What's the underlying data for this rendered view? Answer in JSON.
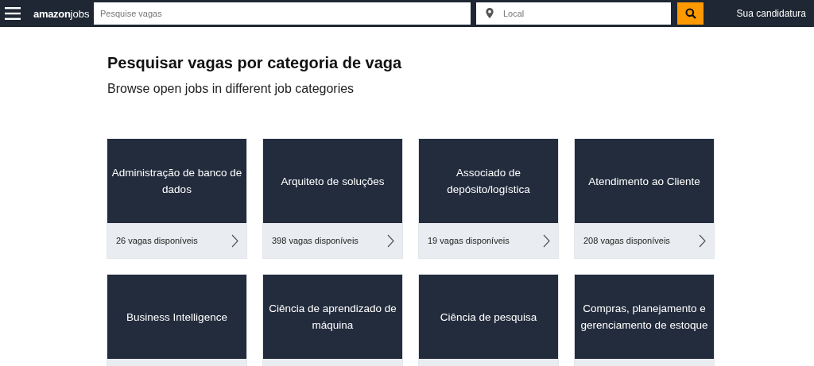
{
  "header": {
    "logo": {
      "brand": "amazon",
      "product": "jobs"
    },
    "search": {
      "placeholder": "Pesquise vagas"
    },
    "location": {
      "placeholder": "Local"
    },
    "account_link": "Sua candidatura"
  },
  "heading": "Pesquisar vagas por categoria de vaga",
  "subheading": "Browse open jobs in different job categories",
  "categories": [
    {
      "title": "Administração de banco de dados",
      "count": "26 vagas disponíveis"
    },
    {
      "title": "Arquiteto de soluções",
      "count": "398 vagas disponíveis"
    },
    {
      "title": "Associado de depósito/logística",
      "count": "19 vagas disponíveis"
    },
    {
      "title": "Atendimento ao Cliente",
      "count": "208 vagas disponíveis"
    },
    {
      "title": "Business Intelligence"
    },
    {
      "title": "Ciência de aprendizado de máquina"
    },
    {
      "title": "Ciência de pesquisa"
    },
    {
      "title": "Compras, planejamento e gerenciamento de estoque"
    }
  ]
}
